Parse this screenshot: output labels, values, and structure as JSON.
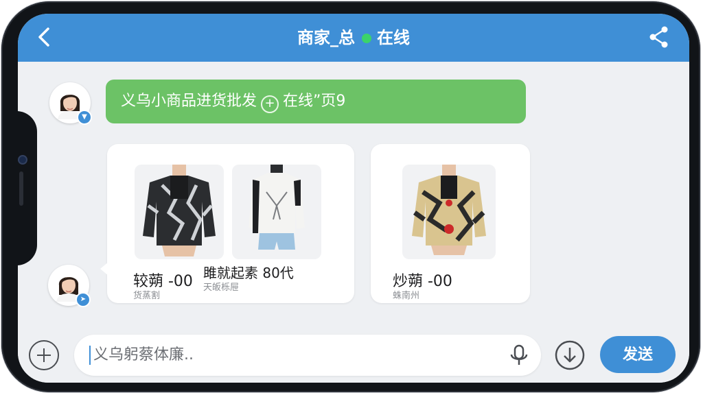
{
  "header": {
    "title": "商家_总",
    "status": "在线",
    "status_color": "#3bd36a",
    "back_icon": "chevron-left-icon",
    "share_icon": "share-icon"
  },
  "messages": {
    "text_message": {
      "part1": "义乌小商品进货批发",
      "icon": "plus-circle-icon",
      "part2": "在线”页9"
    },
    "product_card_1": {
      "items": [
        {
          "image": "black-patterned-jacket",
          "price": "较蒴 -00",
          "sub": "货蒸割"
        },
        {
          "image": "white-top-with-denim-shorts",
          "price": "雎就起素 80代",
          "sub": "天皈栎屉"
        }
      ]
    },
    "product_card_2": {
      "items": [
        {
          "image": "gold-camo-jacket",
          "price": "炒蒴 -00",
          "sub": "蛛南州"
        }
      ]
    }
  },
  "input_bar": {
    "placeholder": "义乌躬蔡体廉..",
    "add_icon": "plus-circle-icon",
    "mic_icon": "microphone-icon",
    "down_icon": "download-circle-icon",
    "send_label": "发送"
  },
  "colors": {
    "accent": "#3f8fd6",
    "bubble_green": "#6cc266",
    "background": "#eef0f3"
  }
}
